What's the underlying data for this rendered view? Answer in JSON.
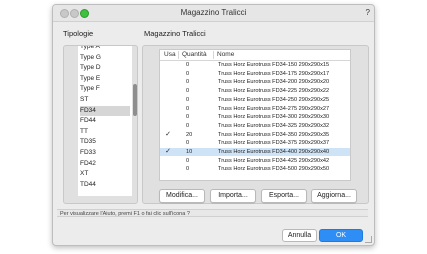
{
  "window": {
    "title": "Magazzino Tralicci",
    "help": "?"
  },
  "tipologie": {
    "label": "Tipologie",
    "items": [
      "Type A",
      "Type G",
      "Type D",
      "Type E",
      "Type F",
      "ST",
      "FD34",
      "FD44",
      "TT",
      "TD35",
      "FD33",
      "FD42",
      "XT",
      "TD44"
    ],
    "selected": "FD34"
  },
  "magazzino": {
    "label": "Magazzino Tralicci",
    "columns": [
      "Usa",
      "Quantità",
      "Nome"
    ],
    "rows": [
      {
        "use": "",
        "qty": "0",
        "name": "Truss Horz Eurotruss FD34-150 290x290x15"
      },
      {
        "use": "",
        "qty": "0",
        "name": "Truss Horz Eurotruss FD34-175 290x290x17"
      },
      {
        "use": "",
        "qty": "0",
        "name": "Truss Horz Eurotruss FD34-200 290x290x20"
      },
      {
        "use": "",
        "qty": "0",
        "name": "Truss Horz Eurotruss FD34-225 290x290x22"
      },
      {
        "use": "",
        "qty": "0",
        "name": "Truss Horz Eurotruss FD34-250 290x290x25"
      },
      {
        "use": "",
        "qty": "0",
        "name": "Truss Horz Eurotruss FD34-275 290x290x27"
      },
      {
        "use": "",
        "qty": "0",
        "name": "Truss Horz Eurotruss FD34-300 290x290x30"
      },
      {
        "use": "",
        "qty": "0",
        "name": "Truss Horz Eurotruss FD34-325 290x290x32"
      },
      {
        "use": "✓",
        "qty": "20",
        "name": "Truss Horz Eurotruss FD34-350 290x290x35"
      },
      {
        "use": "",
        "qty": "0",
        "name": "Truss Horz Eurotruss FD34-375 290x290x37"
      },
      {
        "use": "✓",
        "qty": "10",
        "name": "Truss Horz Eurotruss FD34-400 290x290x40"
      },
      {
        "use": "",
        "qty": "0",
        "name": "Truss Horz Eurotruss FD34-425 290x290x42"
      },
      {
        "use": "",
        "qty": "0",
        "name": "Truss Horz Eurotruss FD34-500 290x290x50"
      }
    ],
    "selected_row_index": 10
  },
  "buttons": {
    "modifica": "Modifica...",
    "importa": "Importa...",
    "esporta": "Esporta...",
    "aggiorna": "Aggiorna..."
  },
  "status": "Per visualizzare l'Aiuto, premi F1 o fai clic sull'icona ?",
  "footer": {
    "cancel": "Annulla",
    "ok": "OK"
  },
  "colors": {
    "accent": "#2f8ef5",
    "selection": "#cfe3f7",
    "zoom": "#3fc03f"
  }
}
